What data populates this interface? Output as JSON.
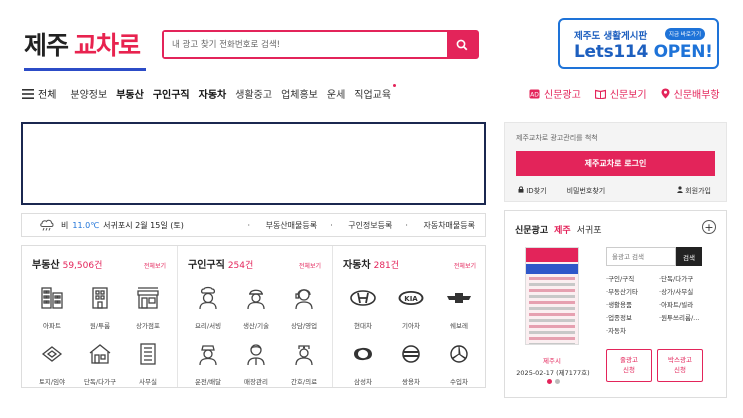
{
  "logo": {
    "part1": "제주",
    "part2": "교차로"
  },
  "search": {
    "placeholder": "내 광고 찾기 전화번호로 검색!"
  },
  "banner": {
    "line1": "제주도 생활게시판",
    "badge": "지금 바로가기",
    "line2a": "Lets114",
    "line2b": "OPEN!"
  },
  "nav": {
    "all_label": "전체",
    "items": [
      {
        "label": "분양정보",
        "bold": false
      },
      {
        "label": "부동산",
        "bold": true
      },
      {
        "label": "구인구직",
        "bold": true
      },
      {
        "label": "자동차",
        "bold": true
      },
      {
        "label": "생활중고",
        "bold": false
      },
      {
        "label": "업체홍보",
        "bold": false
      },
      {
        "label": "운세",
        "bold": false
      },
      {
        "label": "직업교육",
        "bold": false
      }
    ],
    "right": [
      {
        "label": "신문광고",
        "icon": "newspaper-ad-icon"
      },
      {
        "label": "신문보기",
        "icon": "book-icon"
      },
      {
        "label": "신문배부항",
        "icon": "location-pin-icon"
      }
    ]
  },
  "weather": {
    "condition": "비",
    "temp": "11.0℃",
    "place_date": "서귀포시 2월 15일 (토)",
    "links": [
      "부동산매물등록",
      "구인정보등록",
      "자동차매물등록"
    ]
  },
  "categories": [
    {
      "title": "부동산",
      "count": "59,506건",
      "more": "전체보기",
      "items": [
        {
          "label": "아파트",
          "icon": "apartment-icon"
        },
        {
          "label": "원/투룸",
          "icon": "building-icon"
        },
        {
          "label": "상가점포",
          "icon": "store-icon"
        },
        {
          "label": "토지/임야",
          "icon": "land-icon"
        },
        {
          "label": "단독/다가구",
          "icon": "house-icon"
        },
        {
          "label": "사무실",
          "icon": "office-icon"
        }
      ]
    },
    {
      "title": "구인구직",
      "count": "254건",
      "more": "전체보기",
      "items": [
        {
          "label": "요리/서빙",
          "icon": "chef-icon"
        },
        {
          "label": "생산/기술",
          "icon": "worker-icon"
        },
        {
          "label": "상담/영업",
          "icon": "consultant-icon"
        },
        {
          "label": "운전/배달",
          "icon": "driver-icon"
        },
        {
          "label": "매장관리",
          "icon": "staff-icon"
        },
        {
          "label": "간호/의료",
          "icon": "nurse-icon"
        }
      ]
    },
    {
      "title": "자동차",
      "count": "281건",
      "more": "전체보기",
      "items": [
        {
          "label": "현대차",
          "icon": "hyundai-icon"
        },
        {
          "label": "기아차",
          "icon": "kia-icon"
        },
        {
          "label": "쉐보레",
          "icon": "chevrolet-icon"
        },
        {
          "label": "삼성차",
          "icon": "samsung-car-icon"
        },
        {
          "label": "쌍용차",
          "icon": "ssangyong-icon"
        },
        {
          "label": "수입차",
          "icon": "benz-icon"
        }
      ]
    }
  ],
  "login": {
    "note": "제주교차로 광고관리를 척척",
    "button": "제주교차로 로그인",
    "find_id": "ID찾기",
    "find_pw": "비밀번호찾기",
    "join": "회원가입"
  },
  "newspaper": {
    "tab_title": "신문광고",
    "tab_active": "제주",
    "tab_other": "서귀포",
    "city": "제주시",
    "date": "2025-02-17 (제7177호)",
    "search_placeholder": "올광고 검색",
    "search_button": "검색",
    "cats": [
      "구인/구직",
      "단독/다가구",
      "부동산기타",
      "상가/사무실",
      "생활용품",
      "아파트/빌라",
      "업종정보",
      "원투쓰리룸/...",
      "자동차"
    ],
    "btn1": [
      "줄광고",
      "신청"
    ],
    "btn2": [
      "박스광고",
      "신청"
    ]
  },
  "colors": {
    "accent": "#e3245a",
    "brand_blue": "#2c4cc7",
    "banner_blue": "#1e73d8"
  }
}
